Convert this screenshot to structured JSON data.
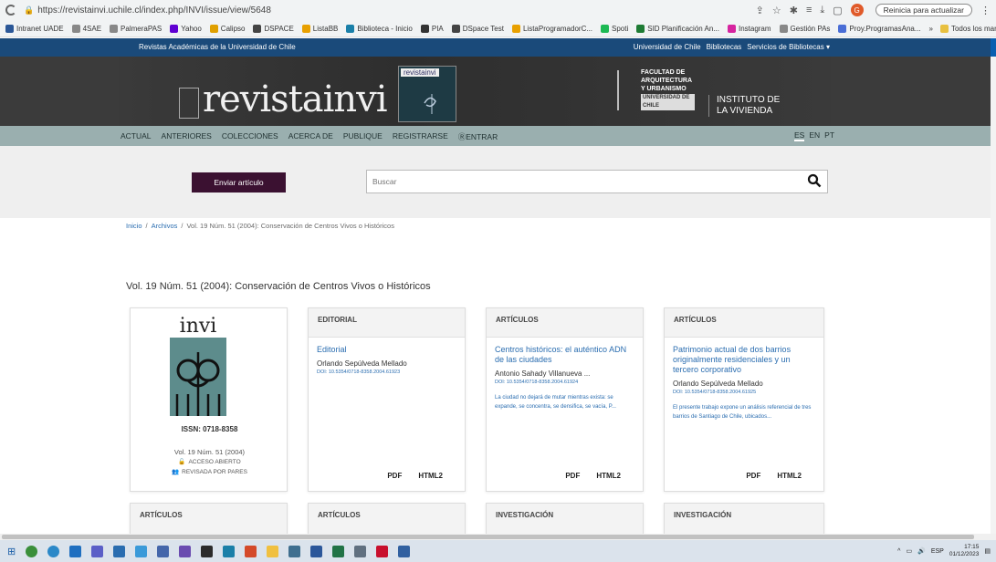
{
  "browser": {
    "url": "https://revistainvi.uchile.cl/index.php/INVI/issue/view/5648",
    "profile_initial": "G",
    "update_button": "Reinicia para actualizar",
    "bookmarks": [
      {
        "label": "Intranet UADE",
        "color": "#2b5797"
      },
      {
        "label": "4SAE",
        "color": "#888888"
      },
      {
        "label": "PalmeraPAS",
        "color": "#888888"
      },
      {
        "label": "Yahoo",
        "color": "#6001d2"
      },
      {
        "label": "Calipso",
        "color": "#e0a000"
      },
      {
        "label": "DSPACE",
        "color": "#444444"
      },
      {
        "label": "ListaBB",
        "color": "#e8a000"
      },
      {
        "label": "Biblioteca - Inicio",
        "color": "#1a7fa8"
      },
      {
        "label": "PIA",
        "color": "#333333"
      },
      {
        "label": "DSpace Test",
        "color": "#444444"
      },
      {
        "label": "ListaProgramadorC...",
        "color": "#e8a000"
      },
      {
        "label": "Spoti",
        "color": "#1db954"
      },
      {
        "label": "SID Planificación An...",
        "color": "#1e7b34"
      },
      {
        "label": "Instagram",
        "color": "#d6249f"
      },
      {
        "label": "Gestión PAs",
        "color": "#888888"
      },
      {
        "label": "Proy.ProgramasAna...",
        "color": "#4a6ed6"
      }
    ],
    "bookmarks_more": "»",
    "all_bookmarks": "Todos los marcadores"
  },
  "site": {
    "topbar_left": "Revistas Académicas de la Universidad de Chile",
    "topbar_links": [
      "Universidad de Chile",
      "Bibliotecas",
      "Servicios de Bibliotecas ▾"
    ],
    "logo_text": "revistainvi",
    "cover_mini_label": "revistainvi",
    "fau_lines": [
      "FACULTAD DE",
      "ARQUITECTURA",
      "Y URBANISMO"
    ],
    "fau_bar": "UNIVERSIDAD DE CHILE",
    "instituto": [
      "INSTITUTO DE",
      "LA VIVIENDA"
    ],
    "nav": [
      "ACTUAL",
      "ANTERIORES",
      "COLECCIONES",
      "ACERCA DE",
      "PUBLIQUE",
      "REGISTRARSE",
      "ENTRAR"
    ],
    "langs": [
      "ES",
      "EN",
      "PT"
    ],
    "submit_label": "Enviar artículo",
    "search_placeholder": "Buscar"
  },
  "breadcrumb": {
    "home": "Inicio",
    "sep": "/",
    "archives": "Archivos",
    "current": "Vol. 19 Núm. 51 (2004): Conservación de Centros Vivos o Históricos"
  },
  "issue_title": "Vol. 19 Núm. 51 (2004): Conservación de Centros Vivos o Históricos",
  "cover": {
    "title": "invi",
    "issn": "ISSN: 0718-8358",
    "volume": "Vol. 19 Núm. 51 (2004)",
    "open_access": "ACCESO ABIERTO",
    "peer_review": "REVISADA POR PARES"
  },
  "cards": [
    {
      "section": "EDITORIAL",
      "title": "Editorial",
      "author": "Orlando Sepúlveda Mellado",
      "doi": "DOI: 10.5354/0718-8358.2004.61923",
      "excerpt": "",
      "pdf": "PDF",
      "html": "HTML2"
    },
    {
      "section": "ARTÍCULOS",
      "title": "Centros históricos: el auténtico ADN de las ciudades",
      "author": "Antonio Sahady Villanueva ...",
      "doi": "DOI: 10.5354/0718-8358.2004.61924",
      "excerpt": "La ciudad no dejará de mutar mientras exista: se expande, se concentra, se densifica, se vacía, P...",
      "pdf": "PDF",
      "html": "HTML2"
    },
    {
      "section": "ARTÍCULOS",
      "title": "Patrimonio actual de dos barrios originalmente residenciales y un tercero corporativo",
      "author": "Orlando Sepúlveda Mellado",
      "doi": "DOI: 10.5354/0718-8358.2004.61925",
      "excerpt": "El presente trabajo expone un análisis referencial de tres barrios de Santiago de Chile, ubicados...",
      "pdf": "PDF",
      "html": "HTML2"
    }
  ],
  "next_row": [
    "ARTÍCULOS",
    "ARTÍCULOS",
    "INVESTIGACIÓN",
    "INVESTIGACIÓN"
  ],
  "taskbar": {
    "lang": "ESP",
    "time": "17:15",
    "date": "01/12/2023"
  }
}
